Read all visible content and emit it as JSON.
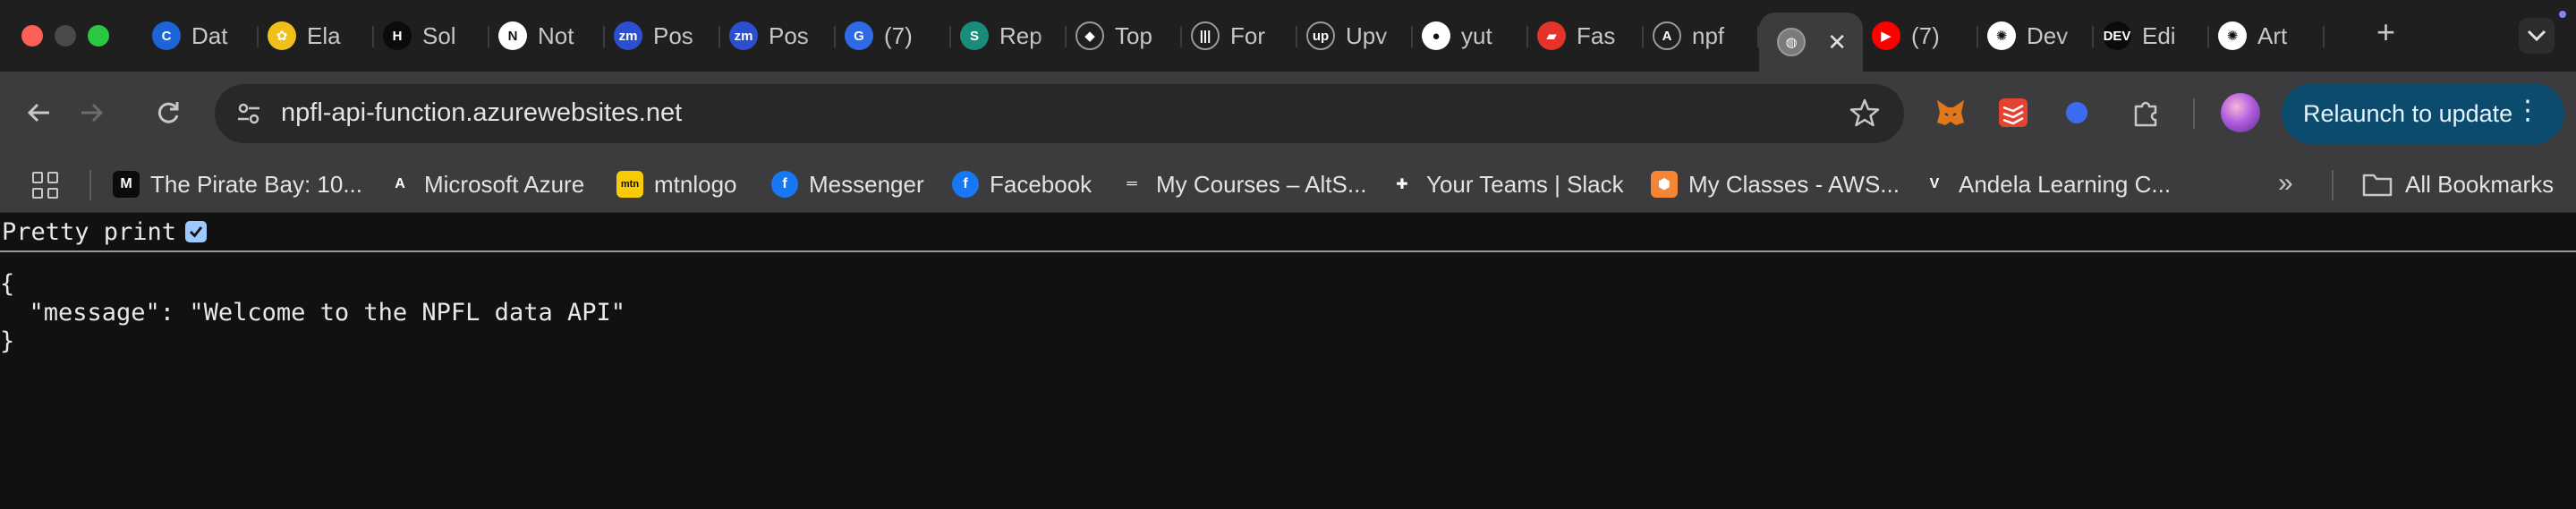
{
  "window": {
    "traffic_lights": [
      "close",
      "minimize",
      "maximize"
    ]
  },
  "tabs": [
    {
      "title": "Dat",
      "icon": "c-logo-icon",
      "color": "#1c64d8",
      "glyph": "C"
    },
    {
      "title": "Ela",
      "icon": "elastic-icon",
      "color": "#f0bf1a",
      "glyph": "✿"
    },
    {
      "title": "Sol",
      "icon": "sol-icon",
      "color": "#0b0b0b",
      "glyph": "H"
    },
    {
      "title": "Not",
      "icon": "notion-icon",
      "color": "#ffffff",
      "glyph": "N"
    },
    {
      "title": "Pos",
      "icon": "zm-icon",
      "color": "#2b4fcf",
      "glyph": "zm"
    },
    {
      "title": "Pos",
      "icon": "zm-icon",
      "color": "#2b4fcf",
      "glyph": "zm"
    },
    {
      "title": "(7)",
      "icon": "g-badge-icon",
      "color": "#2f6ae6",
      "glyph": "G"
    },
    {
      "title": "Rep",
      "icon": "s-icon",
      "color": "#1a8c7a",
      "glyph": "S"
    },
    {
      "title": "Top",
      "icon": "diamond-icon",
      "color": "#1f1f20",
      "glyph": "◆"
    },
    {
      "title": "For",
      "icon": "waveform-icon",
      "color": "#1f1f20",
      "glyph": "|||"
    },
    {
      "title": "Upv",
      "icon": "upwork-icon",
      "color": "#1f1f20",
      "glyph": "up"
    },
    {
      "title": "yut",
      "icon": "github-icon",
      "color": "#ffffff",
      "glyph": "●"
    },
    {
      "title": "Fas",
      "icon": "fast-icon",
      "color": "#e2342a",
      "glyph": "▰"
    },
    {
      "title": "npf",
      "icon": "azure-icon",
      "color": "#1f1f20",
      "glyph": "A"
    },
    {
      "title": "",
      "icon": "globe-icon",
      "color": "#7a7a7d",
      "glyph": "◍",
      "active": true
    },
    {
      "title": "(7)",
      "icon": "youtube-icon",
      "color": "#ff0000",
      "glyph": "▶"
    },
    {
      "title": "Dev",
      "icon": "openai-icon",
      "color": "#ffffff",
      "glyph": "✺"
    },
    {
      "title": "Edi",
      "icon": "dev-icon",
      "color": "#0b0b0b",
      "glyph": "DEV"
    },
    {
      "title": "Art",
      "icon": "openai-icon",
      "color": "#ffffff",
      "glyph": "✺"
    }
  ],
  "toolbar": {
    "url": "npfl-api-function.azurewebsites.net",
    "relaunch_label": "Relaunch to update"
  },
  "extensions": [
    {
      "icon": "metamask-icon",
      "color": "#e2761b"
    },
    {
      "icon": "todoist-icon",
      "color": "#e44332"
    },
    {
      "icon": "blue-dot-icon",
      "color": "#3b6cf0"
    },
    {
      "icon": "puzzle-icon",
      "color": "#c7c7c7"
    }
  ],
  "bookmarks": [
    {
      "label": "The Pirate Bay: 10...",
      "icon": "medium-icon",
      "color": "#0b0b0b",
      "glyph": "M"
    },
    {
      "label": "Microsoft Azure",
      "icon": "azure-icon",
      "color": "#3c3c3f",
      "glyph": "A"
    },
    {
      "label": "mtnlogo",
      "icon": "mtn-icon",
      "color": "#f7cb05",
      "glyph": "mtn"
    },
    {
      "label": "Messenger",
      "icon": "facebook-icon",
      "color": "#1877f2",
      "glyph": "f"
    },
    {
      "label": "Facebook",
      "icon": "facebook-icon",
      "color": "#1877f2",
      "glyph": "f"
    },
    {
      "label": "My Courses – AltS...",
      "icon": "alt-icon",
      "color": "#3c3c3f",
      "glyph": "═"
    },
    {
      "label": "Your Teams | Slack",
      "icon": "slack-icon",
      "color": "#3c3c3f",
      "glyph": "✚"
    },
    {
      "label": "My Classes - AWS...",
      "icon": "aws-cube-icon",
      "color": "#f58536",
      "glyph": "⬢"
    },
    {
      "label": "Andela Learning C...",
      "icon": "andela-icon",
      "color": "#3c3c3f",
      "glyph": "V"
    }
  ],
  "bookmarks_more": "»",
  "all_bookmarks_label": "All Bookmarks",
  "page": {
    "pretty_print_label": "Pretty print",
    "pretty_print_checked": true,
    "json_lines": [
      "{",
      "  \"message\": \"Welcome to the NPFL data API\"",
      "}"
    ]
  }
}
